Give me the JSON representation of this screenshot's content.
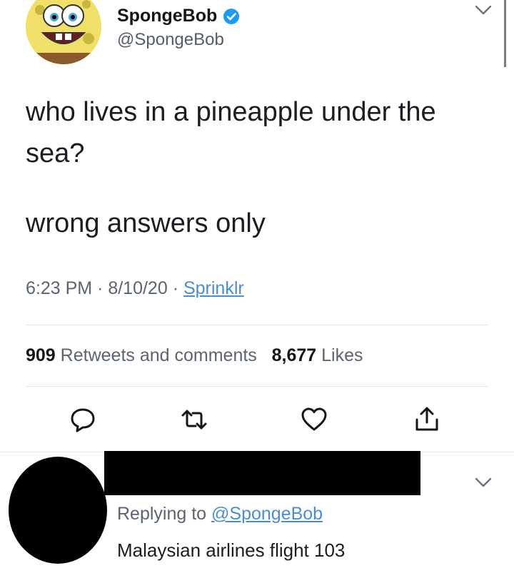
{
  "tweet": {
    "display_name": "SpongeBob",
    "handle": "@SpongeBob",
    "verified": true,
    "text_line1": "who lives in a pineapple under the sea?",
    "text_line2": "wrong answers only",
    "time": "6:23 PM",
    "date": "8/10/20",
    "source": "Sprinklr",
    "meta_sep": " · ",
    "retweets_count": "909",
    "retweets_label": "Retweets and comments",
    "likes_count": "8,677",
    "likes_label": "Likes"
  },
  "actions": {
    "reply": "reply-icon",
    "retweet": "retweet-icon",
    "like": "heart-icon",
    "share": "share-icon"
  },
  "reply": {
    "replying_prefix": "Replying to",
    "replying_to": "@SpongeBob",
    "text": "Malaysian airlines flight 103"
  },
  "colors": {
    "link_blue": "#4a8cd8",
    "verified_blue": "#1d9bf0",
    "muted_gray": "#5b6470",
    "text_dark": "#14171a"
  }
}
